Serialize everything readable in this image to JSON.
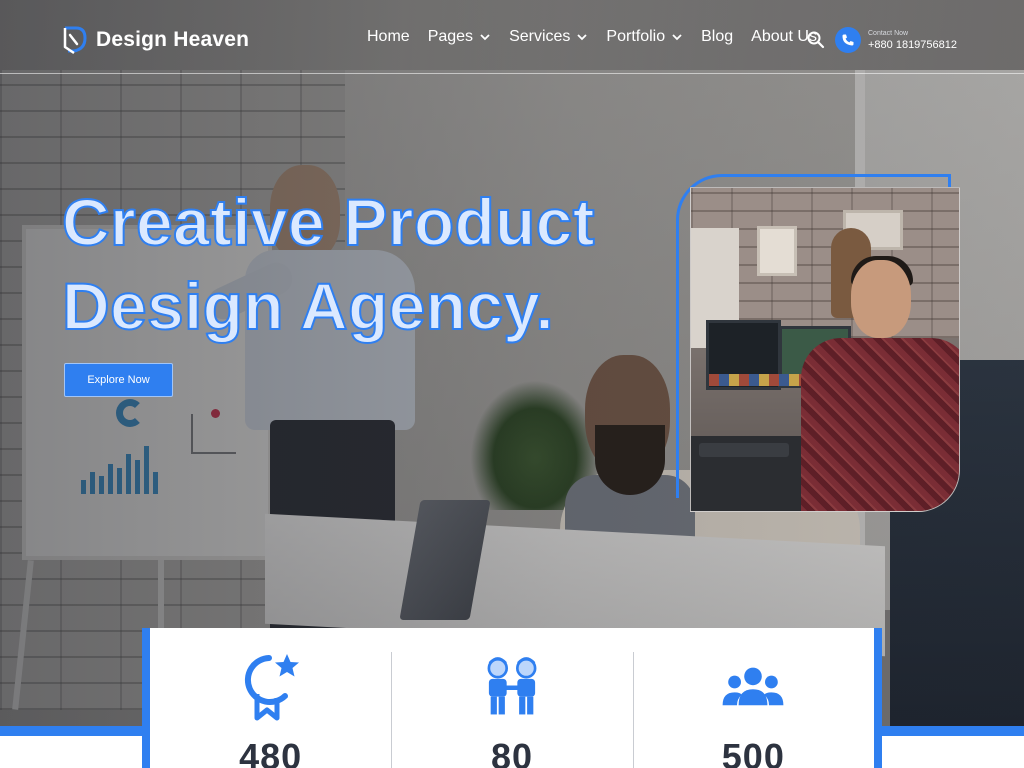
{
  "header": {
    "logo_text": "Design Heaven",
    "nav": [
      {
        "label": "Home",
        "has_dropdown": false
      },
      {
        "label": "Pages",
        "has_dropdown": true
      },
      {
        "label": "Services",
        "has_dropdown": true
      },
      {
        "label": "Portfolio",
        "has_dropdown": true
      },
      {
        "label": "Blog",
        "has_dropdown": false
      },
      {
        "label": "About Us",
        "has_dropdown": false
      }
    ],
    "contact": {
      "label": "Contact Now",
      "phone": "+880 1819756812"
    }
  },
  "hero": {
    "headline_line1": "Creative Product",
    "headline_line2": "Design Agency.",
    "cta_label": "Explore Now"
  },
  "stats": [
    {
      "icon": "award-ribbon-icon",
      "value": "480"
    },
    {
      "icon": "two-kids-icon",
      "value": "80"
    },
    {
      "icon": "team-group-icon",
      "value": "500"
    }
  ],
  "colors": {
    "accent": "#2f7ff0",
    "headline_fill": "#dbe9ff",
    "stat_number": "#2d3340"
  }
}
